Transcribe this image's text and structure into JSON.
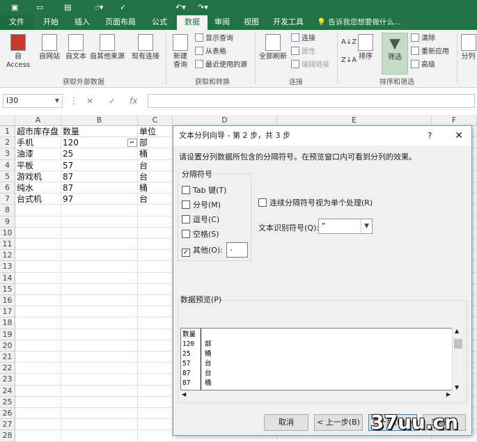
{
  "tabs": [
    "文件",
    "开始",
    "插入",
    "页面布局",
    "公式",
    "数据",
    "审阅",
    "视图",
    "开发工具"
  ],
  "active_tab": "数据",
  "tell_me": "告诉我您想要做什么...",
  "ribbon": {
    "get_external": {
      "buttons": [
        "自 Access",
        "自网站",
        "自文本",
        "自其他来源",
        "现有连接"
      ],
      "label": "获取外部数据"
    },
    "transform": {
      "new_query": "新建\n查询",
      "items": [
        "显示查询",
        "从表格",
        "最近使用的源"
      ],
      "label": "获取和转换"
    },
    "connections": {
      "refresh_all": "全部刷新",
      "items": [
        "连接",
        "属性",
        "编辑链接"
      ],
      "label": "连接"
    },
    "sort_filter": {
      "sort": "排序",
      "filter": "筛选",
      "items": [
        "清除",
        "重新应用",
        "高级"
      ],
      "label": "排序和筛选"
    },
    "split_partial": "分列"
  },
  "formula_bar": {
    "name_box": "I30",
    "fx": "fx",
    "value": ""
  },
  "sheet": {
    "columns": [
      "A",
      "B",
      "C",
      "D",
      "E",
      "F"
    ],
    "rows": [
      [
        "超市库存盘",
        "数量",
        "单位"
      ],
      [
        "手机",
        "120",
        "部"
      ],
      [
        "油漆",
        "25",
        "桶"
      ],
      [
        "平板",
        "57",
        "台"
      ],
      [
        "游戏机",
        "87",
        "台"
      ],
      [
        "纯水",
        "87",
        "桶"
      ],
      [
        "台式机",
        "97",
        "台"
      ]
    ],
    "row_numbers": [
      "1",
      "2",
      "3",
      "4",
      "5",
      "6",
      "7",
      "8",
      "9",
      "10",
      "11",
      "12",
      "13",
      "14",
      "15",
      "16",
      "17",
      "18",
      "19",
      "20",
      "21",
      "22",
      "23",
      "24",
      "25",
      "26",
      "27",
      "28"
    ]
  },
  "dialog": {
    "title": "文本分列向导 - 第 2 步，共 3 步",
    "help": "?",
    "close": "✕",
    "instruction": "请设置分列数据所包含的分隔符号。在预览窗口内可看到分列的效果。",
    "delimiters_label": "分隔符号",
    "delimiters": [
      {
        "label": "Tab 键(T)",
        "checked": false
      },
      {
        "label": "分号(M)",
        "checked": false
      },
      {
        "label": "逗号(C)",
        "checked": false
      },
      {
        "label": "空格(S)",
        "checked": false
      },
      {
        "label": "其他(O):",
        "checked": true
      }
    ],
    "other_value": "-",
    "consecutive": {
      "label": "连续分隔符号视为单个处理(R)",
      "checked": false
    },
    "text_qualifier_label": "文本识别符号(Q):",
    "text_qualifier_value": "\"",
    "preview_label": "数据预览(P)",
    "preview_col1": [
      "数量",
      "120",
      "25",
      "57",
      "87",
      "87"
    ],
    "preview_col2": [
      "",
      "部",
      "桶",
      "台",
      "台",
      "桶"
    ],
    "buttons": {
      "cancel": "取消",
      "back": "< 上一步(B)",
      "next": "下一步(N) >",
      "finish": "完成(F)"
    }
  },
  "watermark": "37uu.cn"
}
